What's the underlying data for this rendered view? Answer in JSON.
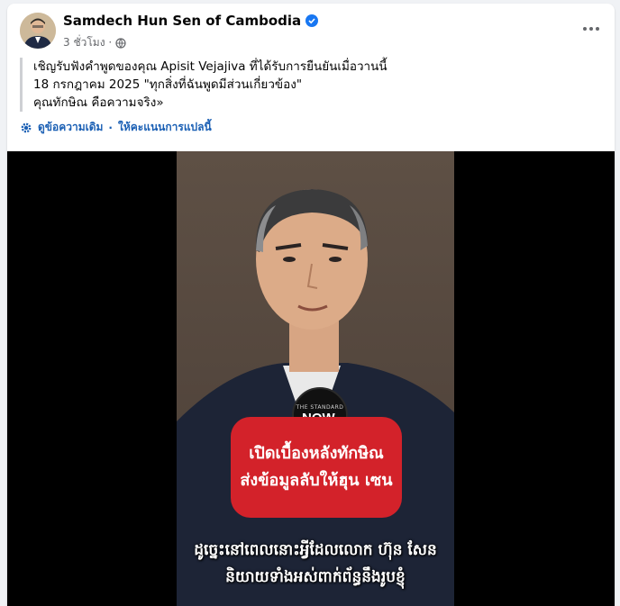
{
  "header": {
    "page_name": "Samdech Hun Sen of Cambodia",
    "timestamp": "3 ชั่วโมง ·",
    "privacy_icon": "globe-icon",
    "verified_icon": "verified-badge-icon",
    "more_icon": "more-options-icon"
  },
  "post": {
    "lines": [
      "เชิญรับฟังคำพูดของคุณ Apisit Vejajiva ที่ได้รับการยืนยันเมื่อวานนี้",
      "18 กรกฎาคม 2025 \"ทุกสิ่งที่ฉันพูดมีส่วนเกี่ยวข้อง\"",
      "คุณทักษิณ คือความจริง»"
    ],
    "see_original": "ดูข้อความเดิม",
    "separator": "·",
    "rate_translation": "ให้คะแนนการแปลนี้"
  },
  "video": {
    "logo_small": "THE STANDARD",
    "logo_big": "NOW.",
    "headline_lines": [
      "เปิดเบื้องหลังทักษิณ",
      "ส่งข้อมูลลับให้ฮุน เซน"
    ],
    "subtitle_lines": [
      "ដូច្នេះនៅពេលនោះអ្វីដែលលោក ហ៊ុន សែន",
      "និយាយទាំងអស់ពាក់ព័ន្ធនឹងរូបខ្ញុំ"
    ]
  },
  "colors": {
    "accent": "#1877f2",
    "link": "#1a5fb4",
    "headline_bg": "#d3222a"
  }
}
